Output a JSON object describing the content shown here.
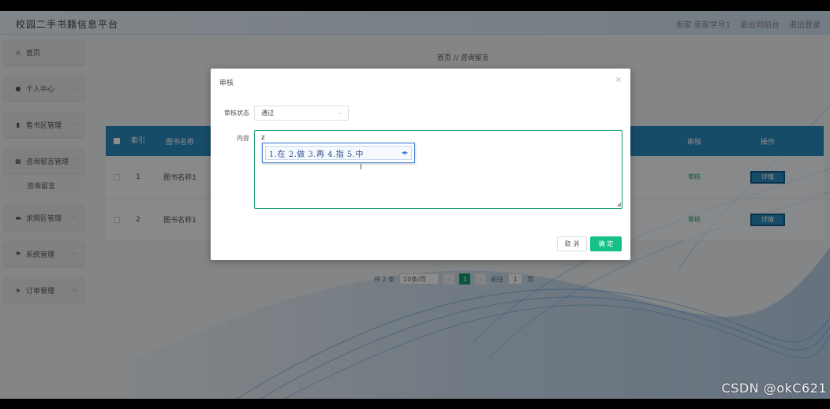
{
  "header": {
    "title": "校园二手书籍信息平台",
    "user": "卖家  卖家学号1",
    "back_link": "退出到前台",
    "logout_link": "退出登录"
  },
  "sidebar": {
    "items": [
      {
        "label": "首页",
        "icon": "home-icon",
        "has_submenu": false
      },
      {
        "label": "个人中心",
        "icon": "user-icon",
        "has_submenu": true
      },
      {
        "label": "售书区管理",
        "icon": "book-icon",
        "has_submenu": true
      },
      {
        "label": "咨询留言管理",
        "icon": "grid-icon",
        "has_submenu": true
      },
      {
        "label": "求购区管理",
        "icon": "cart-icon",
        "has_submenu": true
      },
      {
        "label": "系统管理",
        "icon": "flag-icon",
        "has_submenu": true
      },
      {
        "label": "订单管理",
        "icon": "send-icon",
        "has_submenu": true
      }
    ],
    "submenu_item": "咨询留言"
  },
  "breadcrumb": "首页 // 咨询留言",
  "table": {
    "headers": {
      "index": "索引",
      "name": "图书名称",
      "audit": "审核",
      "op": "操作"
    },
    "rows": [
      {
        "index": "1",
        "name": "图书名称1",
        "audit": "审核",
        "op": "详情"
      },
      {
        "index": "2",
        "name": "图书名称1",
        "audit": "审核",
        "op": "详情"
      }
    ]
  },
  "pagination": {
    "total": "共 2 条",
    "page_size": "10条/页",
    "prev": "‹",
    "current": "1",
    "next": "›",
    "goto_prefix": "前往",
    "goto_value": "1",
    "goto_suffix": "页"
  },
  "modal": {
    "title": "审核",
    "close": "×",
    "status_label": "审核状态",
    "status_value": "通过",
    "content_label": "内容",
    "content_value": "z",
    "ime_candidates": "1.在 2.做 3.再 4.指 5.中",
    "ime_nav": "◂▸",
    "cancel": "取 消",
    "ok": "确 定"
  },
  "watermark": "CSDN @okC621",
  "colors": {
    "primary": "#2a8bbd",
    "success": "#16c089"
  }
}
